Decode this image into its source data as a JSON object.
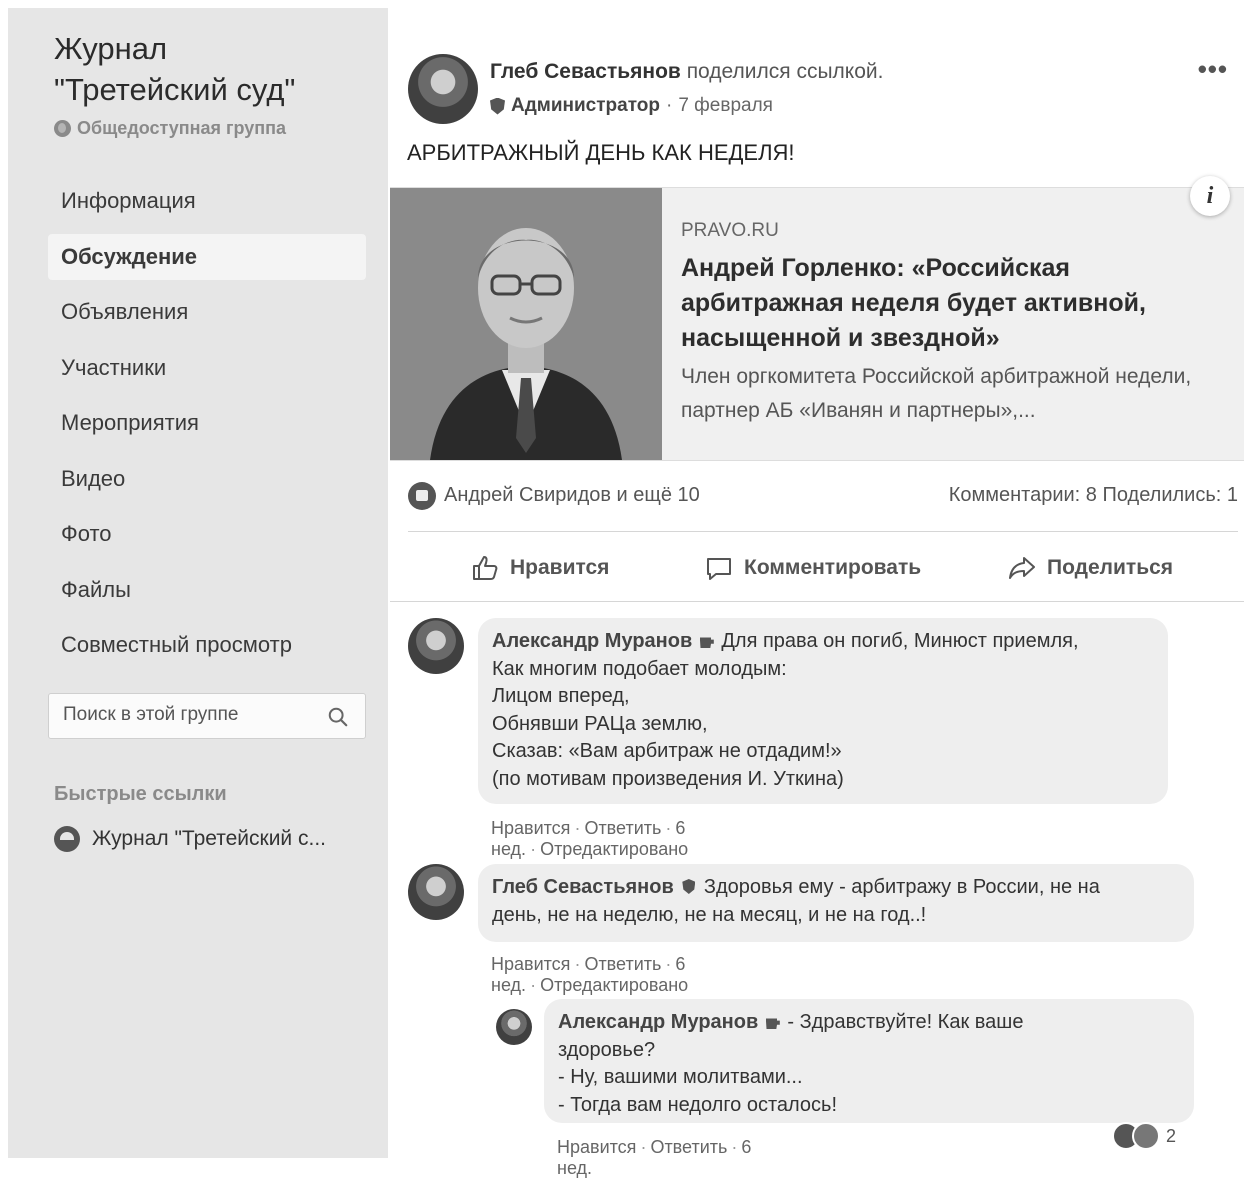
{
  "sidebar": {
    "group_title_line1": "Журнал",
    "group_title_line2": "\"Третейский суд\"",
    "privacy": "Общедоступная группа",
    "nav": [
      {
        "label": "Информация"
      },
      {
        "label": "Обсуждение"
      },
      {
        "label": "Объявления"
      },
      {
        "label": "Участники"
      },
      {
        "label": "Мероприятия"
      },
      {
        "label": "Видео"
      },
      {
        "label": "Фото"
      },
      {
        "label": "Файлы"
      },
      {
        "label": "Совместный просмотр"
      }
    ],
    "active_nav": "Обсуждение",
    "search_placeholder": "Поиск в этой группе",
    "quick_links_title": "Быстрые ссылки",
    "quick_link": "Журнал \"Третейский с..."
  },
  "post": {
    "author": "Глеб Севастьянов",
    "action": "поделился ссылкой.",
    "role": "Администратор",
    "date": "7 февраля",
    "text": "АРБИТРАЖНЫЙ ДЕНЬ КАК НЕДЕЛЯ!",
    "more": "•••",
    "link": {
      "source": "PRAVO.RU",
      "title": "Андрей Горленко: «Российская арбитражная неделя будет активной, насыщенной и звездной»",
      "description": "Член оргкомитета Российской арбитражной недели, партнер АБ «Иванян и партнеры»,...",
      "info": "i"
    },
    "reactions": {
      "names": "Андрей Свиридов и ещё 10",
      "comments": "Комментарии: 8",
      "shares": "Поделились: 1"
    },
    "actions": {
      "like": "Нравится",
      "comment": "Комментировать",
      "share": "Поделиться"
    }
  },
  "comments": [
    {
      "author": "Александр Муранов",
      "lines": [
        "Для права он погиб, Минюст приемля,",
        "Как многим подобает молодым:",
        "Лицом вперед,",
        "Обнявши РАЦа землю,",
        "Сказав: «Вам арбитраж не отдадим!»",
        "(по мотивам произведения И. Уткина)"
      ],
      "meta": {
        "like": "Нравится",
        "reply": "Ответить",
        "time": "6 нед.",
        "edited": "Отредактировано"
      }
    },
    {
      "author": "Глеб Севастьянов",
      "lines": [
        "Здоровья ему - арбитражу в России, не на",
        "день, не на неделю, не на месяц, и не на год..!"
      ],
      "meta": {
        "like": "Нравится",
        "reply": "Ответить",
        "time": "6 нед.",
        "edited": "Отредактировано"
      }
    },
    {
      "author": "Александр Муранов",
      "lines": [
        "- Здравствуйте! Как ваше",
        "здоровье?",
        "- Ну, вашими молитвами...",
        "- Тогда вам недолго осталось!"
      ],
      "meta": {
        "like": "Нравится",
        "reply": "Ответить",
        "time": "6 нед."
      },
      "reaction_count": "2"
    }
  ]
}
